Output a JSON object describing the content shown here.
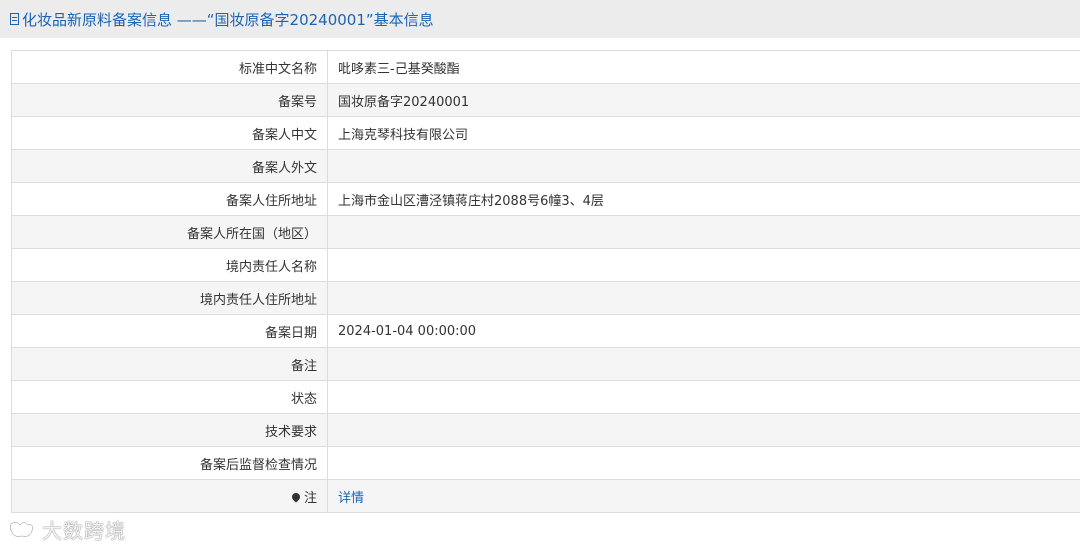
{
  "header": {
    "title": "化妆品新原料备案信息 ——“国妆原备字20240001”基本信息"
  },
  "rows": [
    {
      "label": "标准中文名称",
      "value": "吡哆素三-己基癸酸酯"
    },
    {
      "label": "备案号",
      "value": "国妆原备字20240001"
    },
    {
      "label": "备案人中文",
      "value": "上海克琴科技有限公司"
    },
    {
      "label": "备案人外文",
      "value": ""
    },
    {
      "label": "备案人住所地址",
      "value": "上海市金山区漕泾镇蒋庄村2088号6幢3、4层"
    },
    {
      "label": "备案人所在国（地区）",
      "value": ""
    },
    {
      "label": "境内责任人名称",
      "value": ""
    },
    {
      "label": "境内责任人住所地址",
      "value": ""
    },
    {
      "label": "备案日期",
      "value": "2024-01-04 00:00:00"
    },
    {
      "label": "备注",
      "value": ""
    },
    {
      "label": "状态",
      "value": ""
    },
    {
      "label": "技术要求",
      "value": ""
    },
    {
      "label": "备案后监督检查情况",
      "value": ""
    },
    {
      "label": "注",
      "value": "详情",
      "icon": "pin-icon"
    }
  ],
  "watermark": {
    "text": "大数跨境"
  },
  "colors": {
    "link": "#1d63b3",
    "header_bg": "#ececec",
    "row_alt_bg": "#f5f5f5",
    "border": "#dcdcdc"
  }
}
